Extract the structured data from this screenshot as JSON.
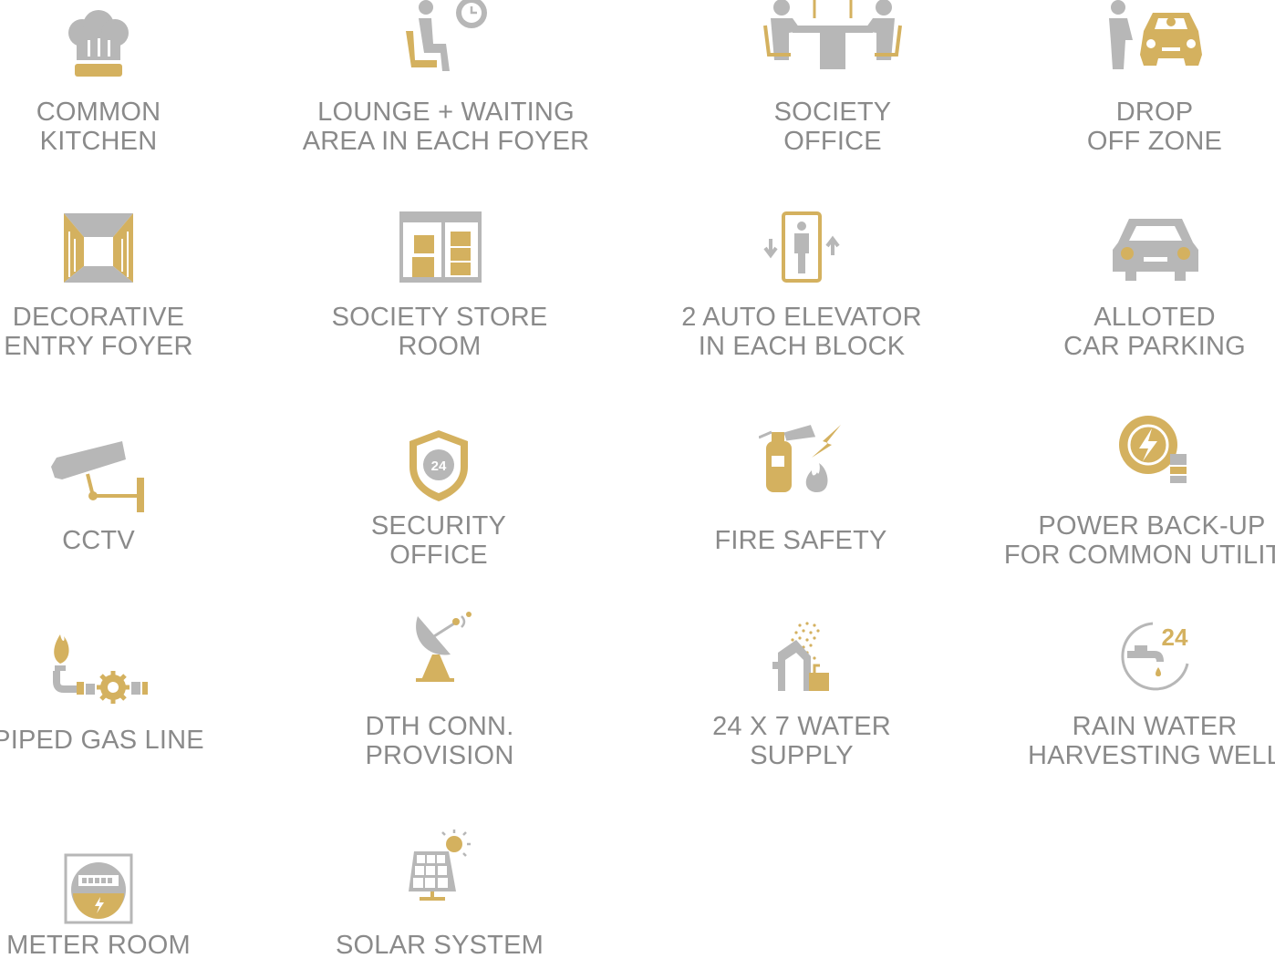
{
  "colors": {
    "gold": "#d4b15f",
    "grey": "#b7b7b7",
    "text": "#8a8a8a"
  },
  "amenities": [
    {
      "icon": "chef-hat-icon",
      "line1": "COMMON",
      "line2": "KITCHEN"
    },
    {
      "icon": "lounge-waiting-icon",
      "line1": "LOUNGE + WAITING",
      "line2": "AREA IN EACH FOYER"
    },
    {
      "icon": "meeting-table-icon",
      "line1": "SOCIETY",
      "line2": "OFFICE"
    },
    {
      "icon": "drop-off-car-icon",
      "line1": "DROP",
      "line2": "OFF ZONE"
    },
    {
      "icon": "entry-foyer-icon",
      "line1": "DECORATIVE",
      "line2": "ENTRY FOYER"
    },
    {
      "icon": "store-room-icon",
      "line1": "SOCIETY STORE",
      "line2": "ROOM"
    },
    {
      "icon": "elevator-icon",
      "line1": "2 AUTO ELEVATOR",
      "line2": "IN EACH BLOCK"
    },
    {
      "icon": "car-parking-icon",
      "line1": "ALLOTED",
      "line2": "CAR PARKING"
    },
    {
      "icon": "cctv-camera-icon",
      "line1": "",
      "line2": "CCTV"
    },
    {
      "icon": "security-shield-24-icon",
      "line1": "SECURITY",
      "line2": "OFFICE"
    },
    {
      "icon": "fire-extinguisher-icon",
      "line1": "",
      "line2": "FIRE SAFETY"
    },
    {
      "icon": "power-backup-icon",
      "line1": "POWER BACK-UP",
      "line2": "FOR COMMON UTILITY"
    },
    {
      "icon": "gas-pipe-icon",
      "line1": "",
      "line2": "PIPED GAS LINE"
    },
    {
      "icon": "satellite-dish-icon",
      "line1": "DTH CONN.",
      "line2": "PROVISION"
    },
    {
      "icon": "water-supply-icon",
      "line1": "24 X 7 WATER",
      "line2": "SUPPLY"
    },
    {
      "icon": "water-tap-24-icon",
      "line1": "RAIN WATER",
      "line2": "HARVESTING WELL",
      "badge": "24"
    },
    {
      "icon": "electric-meter-icon",
      "line1": "",
      "line2": "METER ROOM"
    },
    {
      "icon": "solar-panel-icon",
      "line1": "",
      "line2": "SOLAR SYSTEM"
    }
  ],
  "shield_badge": "24"
}
